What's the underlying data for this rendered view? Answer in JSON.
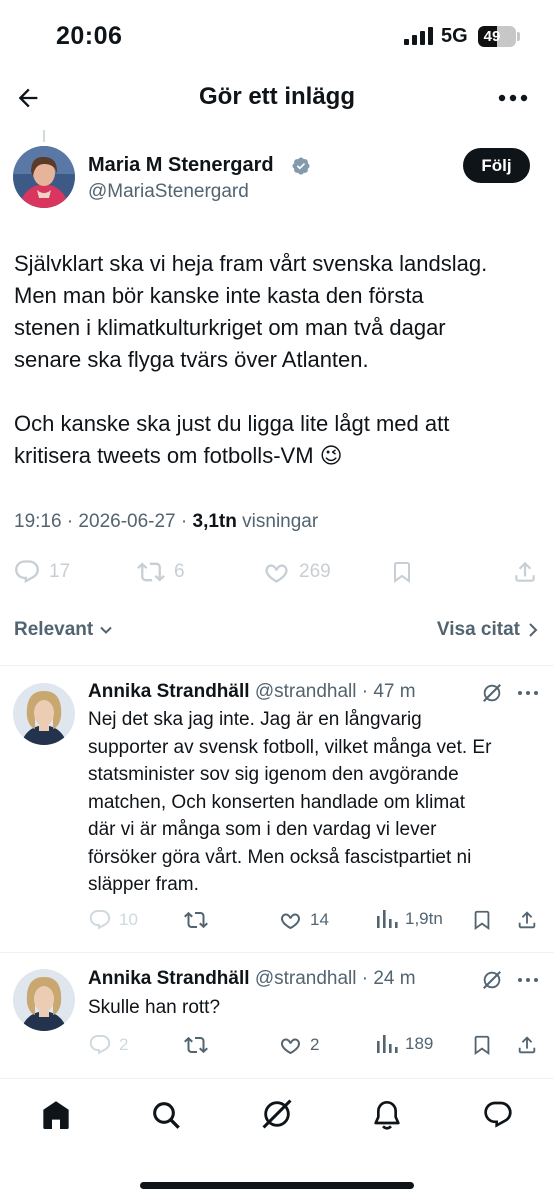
{
  "status_bar": {
    "time": "20:06",
    "network": "5G",
    "battery": "49",
    "battery_level": 0.49
  },
  "header": {
    "title": "Gör ett inlägg",
    "back_icon": "arrow-left-icon",
    "more_icon": "more-horizontal-icon"
  },
  "post": {
    "author_name": "Maria M Stenergard",
    "handle": "@MariaStenergard",
    "verified_color": "#829aab",
    "follow_label": "Följ",
    "paragraph1": "Självklart ska vi heja fram vårt svenska landslag.\nMen man bör kanske inte kasta den första\nstenen i klimatkulturkriget om man två dagar\nsenare ska flyga tvärs över Atlanten.",
    "paragraph2": "Och kanske ska just du ligga lite lågt med att\nkritisera tweets om fotbolls-VM 😉",
    "time_date": "19:16 · 2026-06-27 · ",
    "views_count": "3,1tn",
    "views_label": " visningar",
    "replies": "17",
    "reposts": "6",
    "likes": "269"
  },
  "sort": {
    "label": "Relevant",
    "quotes_label": "Visa citat"
  },
  "replies": [
    {
      "author_name": "Annika Strandhäll",
      "handle": "@strandhall",
      "time": " · 47 m",
      "text": "Nej det ska jag inte. Jag är en långvarig\nsupporter av svensk fotboll, vilket många vet. Er\nstatsminister sov sig igenom den avgörande\nmatchen, Och konserten handlade om klimat\ndär vi är många som i den vardag vi lever\nförsöker göra vårt. Men också fascistpartiet ni\nsläpper fram.",
      "replies": "10",
      "likes": "14",
      "views": "1,9tn"
    },
    {
      "author_name": "Annika Strandhäll",
      "handle": "@strandhall",
      "time": " · 24 m",
      "text": "Skulle han rott?",
      "replies": "2",
      "likes": "2",
      "views": "189"
    }
  ],
  "tabbar": {
    "items": [
      "home-icon",
      "search-icon",
      "grok-icon",
      "notifications-icon",
      "messages-icon"
    ]
  }
}
